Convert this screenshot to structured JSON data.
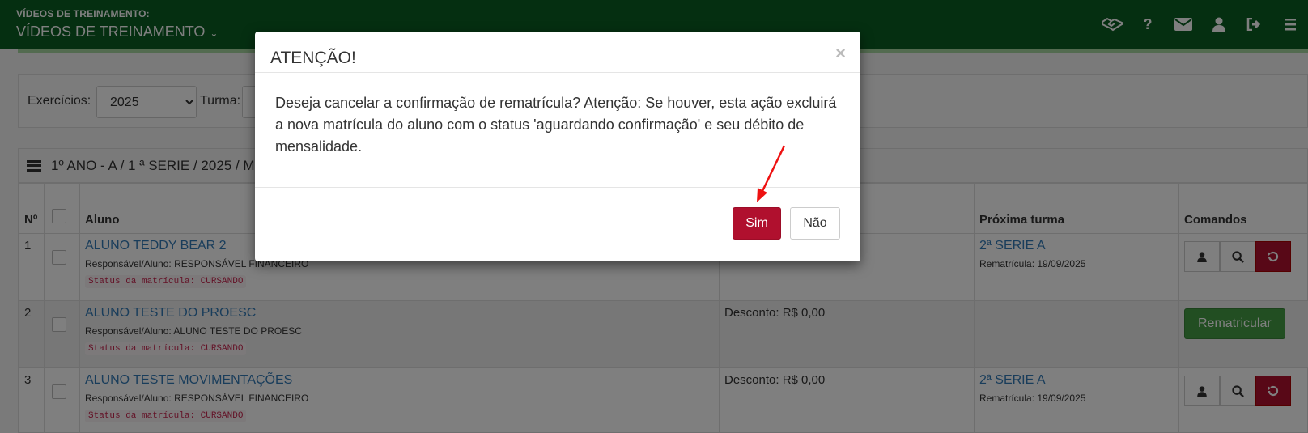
{
  "header": {
    "section_label": "VÍDEOS DE TREINAMENTO:",
    "dropdown_title": "VÍDEOS DE TREINAMENTO",
    "icons": [
      "handshake-icon",
      "help-icon",
      "mail-icon",
      "user-icon",
      "logout-icon",
      "menu-icon"
    ]
  },
  "filters": {
    "year_label": "Exercícios:",
    "year_value": "2025",
    "class_label": "Turma:"
  },
  "panel": {
    "title": "1º ANO - A / 1 ª SERIE / 2025 / M"
  },
  "table": {
    "headers": {
      "num": "Nº",
      "student": "Aluno",
      "next_class": "Próxima turma",
      "commands": "Comandos"
    },
    "rows": [
      {
        "num": "1",
        "name": "ALUNO TEDDY BEAR 2",
        "guardian": "Responsável/Aluno: RESPONSÁVEL FINANCEIRO",
        "status": "Status da matrícula: CURSANDO",
        "discount": "",
        "next_class": "2ª SERIE A",
        "reenroll_date": "Rematrícula: 19/09/2025"
      },
      {
        "num": "2",
        "name": "ALUNO TESTE DO PROESC",
        "guardian": "Responsável/Aluno: ALUNO TESTE DO PROESC",
        "status": "Status da matrícula: CURSANDO",
        "discount": "Desconto: R$ 0,00",
        "next_class": "",
        "reenroll_date": "",
        "action_label": "Rematricular"
      },
      {
        "num": "3",
        "name": "ALUNO TESTE MOVIMENTAÇÕES",
        "guardian": "Responsável/Aluno: RESPONSÁVEL FINANCEIRO",
        "status": "Status da matrícula: CURSANDO",
        "discount": "Desconto: R$ 0,00",
        "next_class": "2ª SERIE A",
        "reenroll_date": "Rematrícula: 19/09/2025"
      }
    ]
  },
  "modal": {
    "title": "ATENÇÃO!",
    "close": "×",
    "message": "Deseja cancelar a confirmação de rematrícula? Atenção: Se houver, esta ação excluirá a nova matrícula do aluno com o status 'aguardando confirmação' e seu débito de mensalidade.",
    "yes_label": "Sim",
    "no_label": "Não"
  },
  "colors": {
    "header_green": "#0b5e22",
    "danger_red": "#b0102e",
    "success_green": "#449d44",
    "link_blue": "#337ab7",
    "annotation_red": "#ee1111"
  }
}
